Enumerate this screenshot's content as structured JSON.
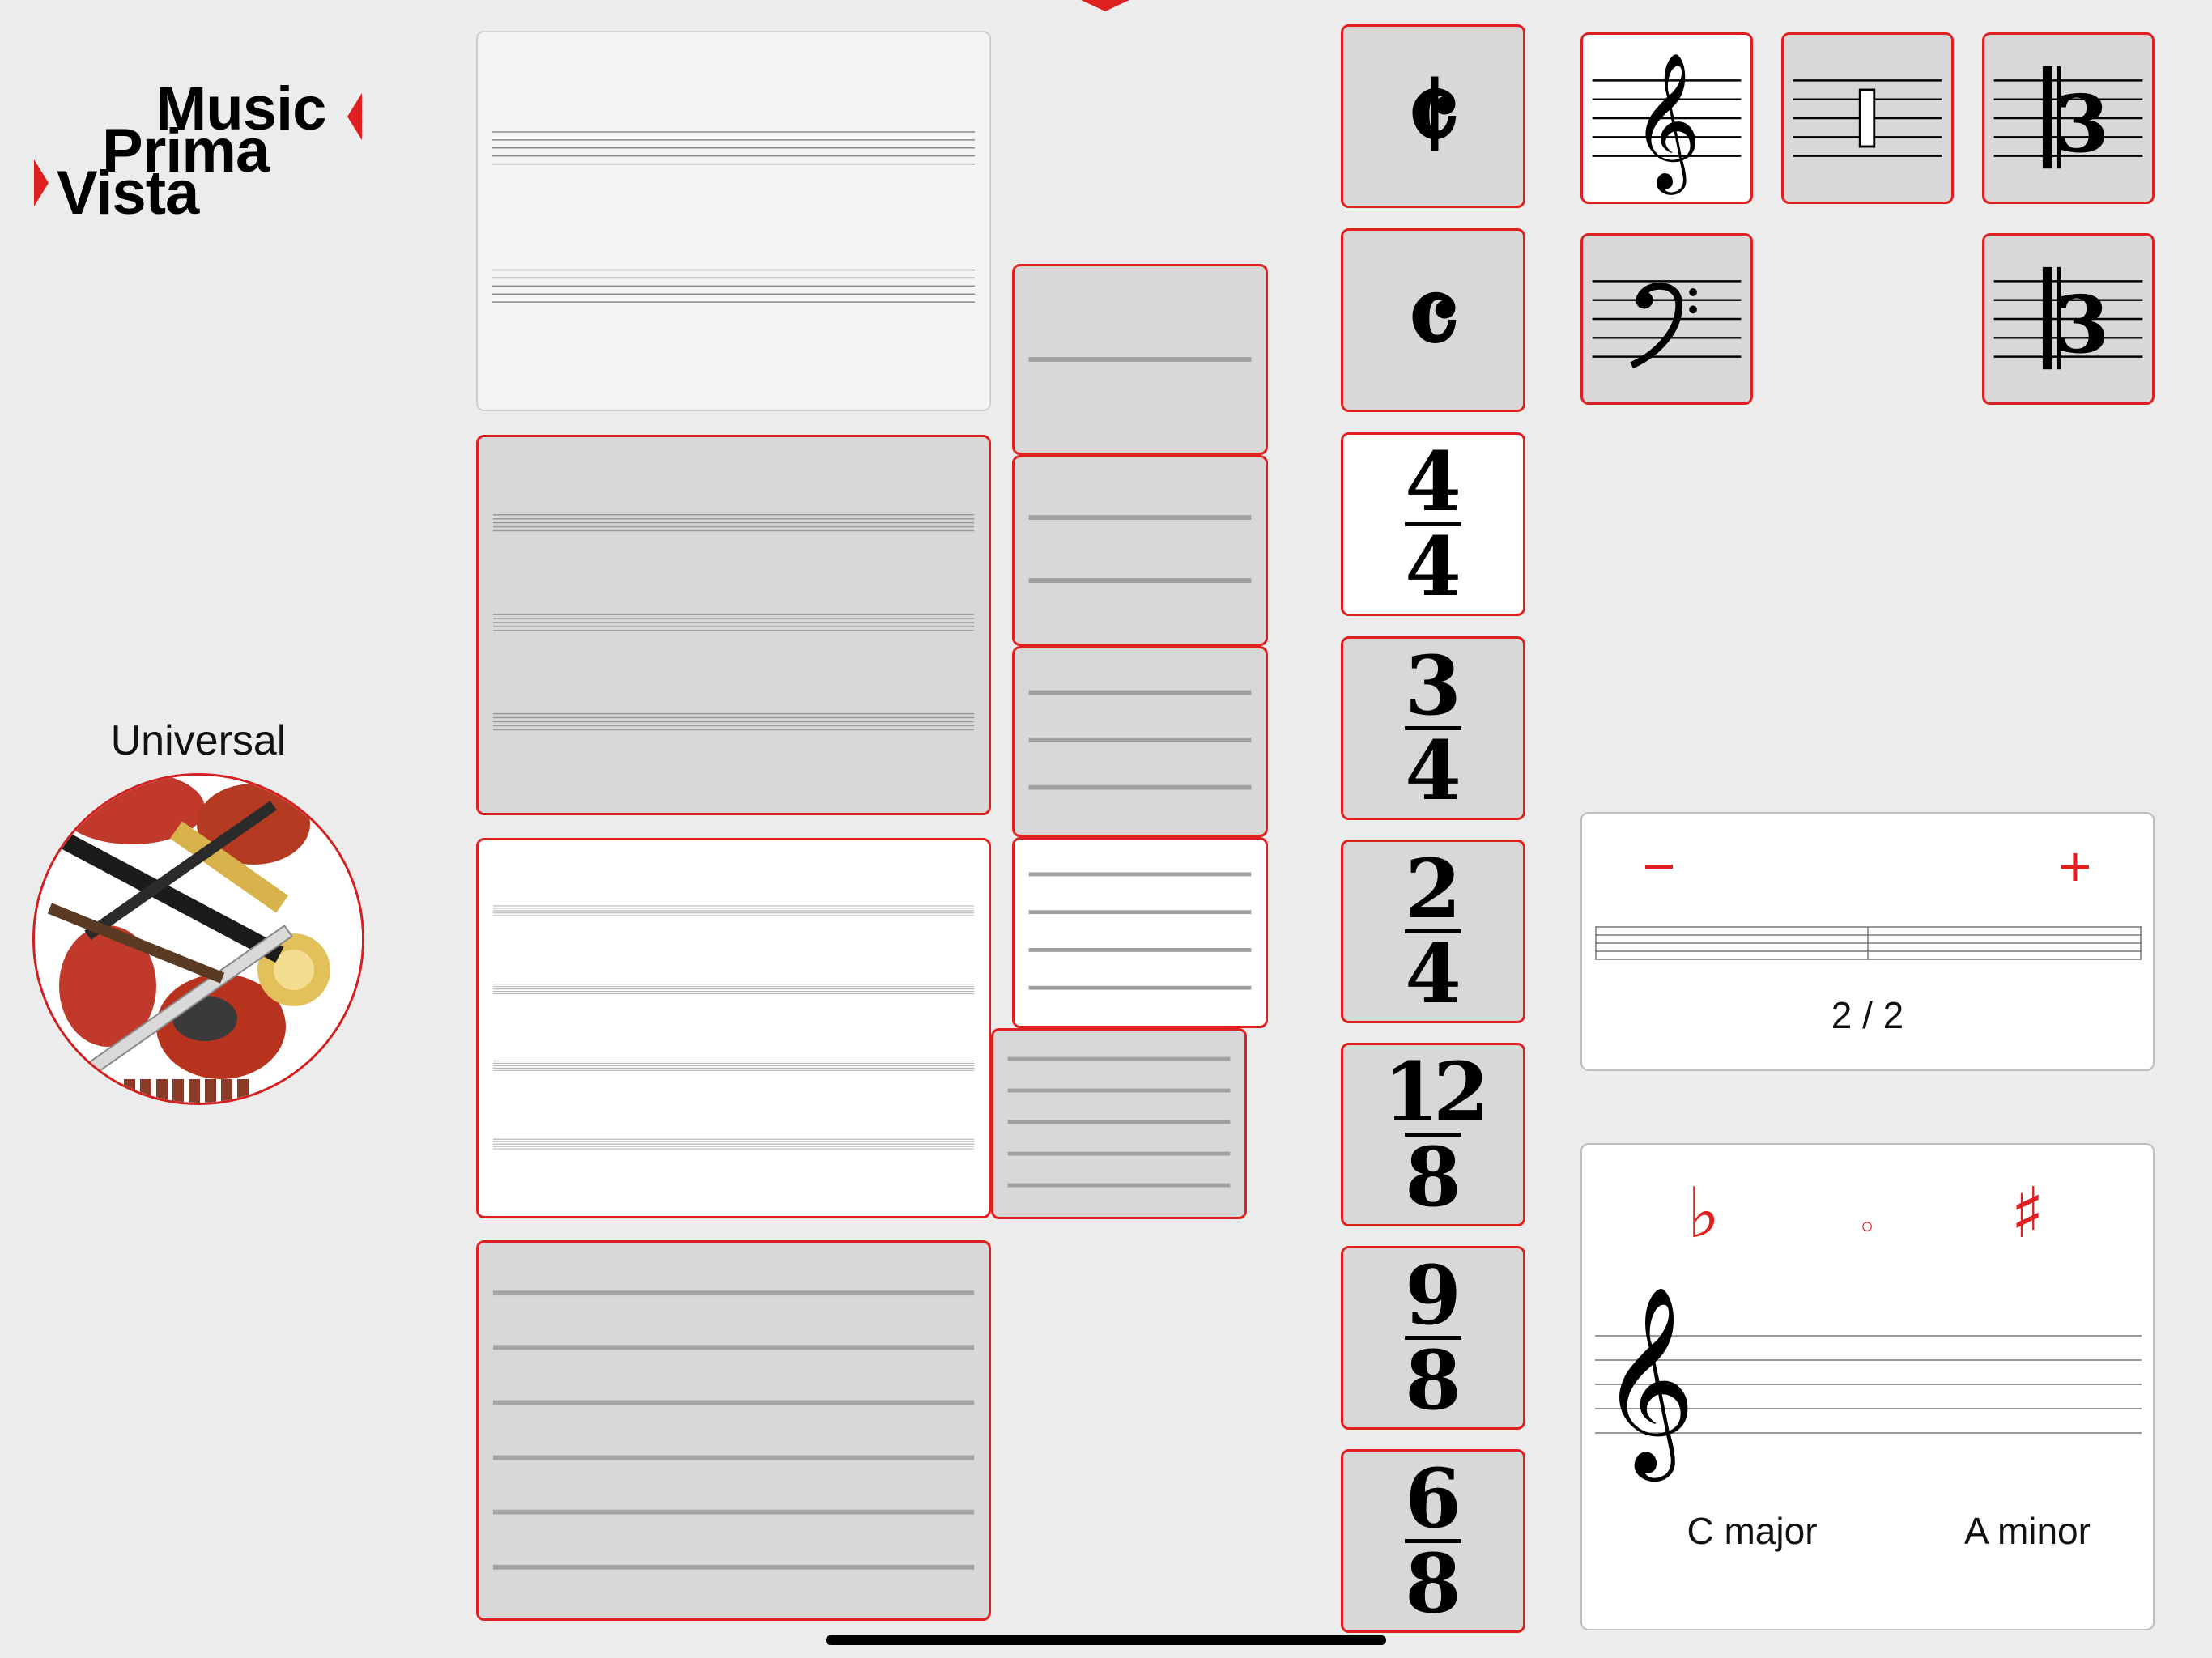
{
  "logo": {
    "line1": "Music",
    "line2": "Prima",
    "line3": "Vista"
  },
  "instrument": {
    "label": "Universal",
    "image": "orchestra-instruments-collage"
  },
  "time_signatures": [
    {
      "kind": "symbol",
      "symbol": "𝄵",
      "name": "cut-time"
    },
    {
      "kind": "symbol",
      "symbol": "𝄴",
      "name": "common-time"
    },
    {
      "kind": "fraction",
      "top": "4",
      "bottom": "4",
      "selected": true
    },
    {
      "kind": "fraction",
      "top": "3",
      "bottom": "4"
    },
    {
      "kind": "fraction",
      "top": "2",
      "bottom": "4"
    },
    {
      "kind": "fraction",
      "top": "12",
      "bottom": "8"
    },
    {
      "kind": "fraction",
      "top": "9",
      "bottom": "8"
    },
    {
      "kind": "fraction",
      "top": "6",
      "bottom": "8"
    }
  ],
  "clefs": [
    {
      "name": "treble-clef",
      "glyph": "𝄞",
      "selected": true
    },
    {
      "name": "percussion-clef",
      "glyph": "𝄥"
    },
    {
      "name": "alto-clef",
      "glyph": "𝄡"
    },
    {
      "name": "bass-clef",
      "glyph": "𝄢"
    },
    {
      "name": "tenor-clef",
      "glyph": "𝄡"
    }
  ],
  "measures_panel": {
    "minus": "−",
    "plus": "+",
    "value": "2 / 2"
  },
  "key_panel": {
    "flat": "♭",
    "natural": "◦",
    "sharp": "♯",
    "clef": "𝄞",
    "major": "C major",
    "minor": "A minor"
  },
  "colors": {
    "accent": "#e02020",
    "card_gray": "#d8d8d8",
    "background": "#ececec"
  }
}
